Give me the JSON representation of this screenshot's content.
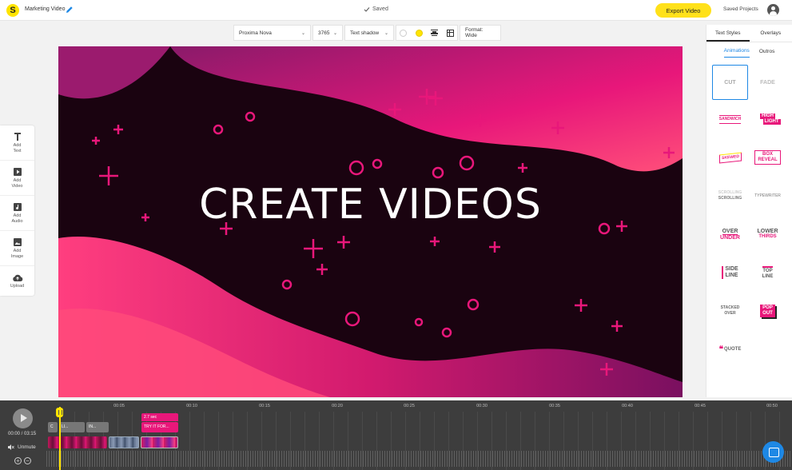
{
  "app": {
    "logo_letter": "S",
    "project_title": "Marketing Video",
    "save_status": "Saved",
    "export_label": "Export Video",
    "saved_projects_label": "Saved Projects"
  },
  "toolbar": {
    "font": "Proxima Nova",
    "size": "3765",
    "shadow": "Text shadow",
    "format": "Format: Wide",
    "color_swatch": "#ffe400"
  },
  "tools": [
    {
      "label1": "Add",
      "label2": "Text",
      "icon": "text-icon"
    },
    {
      "label1": "Add",
      "label2": "Video",
      "icon": "video-icon"
    },
    {
      "label1": "Add",
      "label2": "Audio",
      "icon": "audio-icon"
    },
    {
      "label1": "Add",
      "label2": "Image",
      "icon": "image-icon"
    },
    {
      "label1": "Upload",
      "label2": "",
      "icon": "upload-icon"
    }
  ],
  "canvas": {
    "title": "CREATE VIDEOS",
    "accent": "#e8177a",
    "background": "#1a0310"
  },
  "right_panel": {
    "tabs": [
      "Text Styles",
      "Overlays"
    ],
    "subtabs": [
      "Animations",
      "Outros"
    ],
    "animations": [
      {
        "a": "CUT",
        "b": ""
      },
      {
        "a": "FADE",
        "b": ""
      },
      {
        "a": "SANDWICH",
        "b": ""
      },
      {
        "a": "HIGH",
        "b": "LIGHT"
      },
      {
        "a": "SKEWED",
        "b": ""
      },
      {
        "a": "BOX",
        "b": "REVEAL"
      },
      {
        "a": "SCROLLING",
        "b": "SCROLLING"
      },
      {
        "a": "TYPEWRITER",
        "b": ""
      },
      {
        "a": "OVER",
        "b": "UNDER"
      },
      {
        "a": "LOWER",
        "b": "THIRDS"
      },
      {
        "a": "SIDE",
        "b": "LINE"
      },
      {
        "a": "TOP",
        "b": "LINE"
      },
      {
        "a": "STACKED",
        "b": "OVER"
      },
      {
        "a": "POP",
        "b": "OUT"
      },
      {
        "a": "QUOTE",
        "b": ""
      }
    ]
  },
  "timeline": {
    "time": "00:00 / 03:15",
    "unmute_label": "Unmute",
    "ticks": [
      "00:05",
      "00:10",
      "00:15",
      "00:20",
      "00:25",
      "00:30",
      "00:35",
      "00:40",
      "00:45",
      "00:50"
    ],
    "text_clips": [
      "C",
      "LI...",
      "IN...",
      "TRY IT FOR..."
    ],
    "selected_duration": "2.7 sec"
  }
}
